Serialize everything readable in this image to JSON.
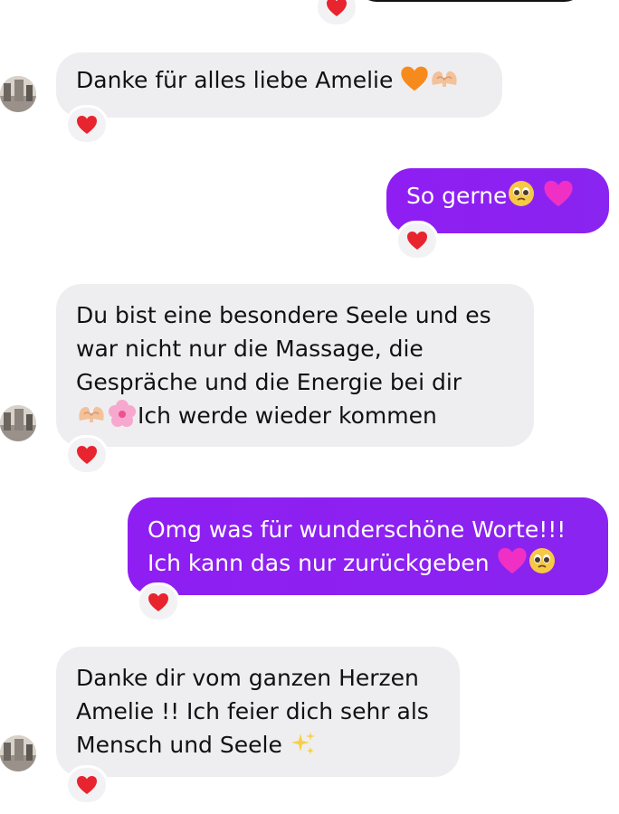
{
  "messages": [
    {
      "direction": "incoming",
      "lines": [
        "Danke für alles liebe Amelie"
      ],
      "trailing_emoji": [
        "orange-heart-icon",
        "heart-hands-icon"
      ],
      "reaction": "red-heart-icon"
    },
    {
      "direction": "outgoing",
      "lines": [
        "So gerne"
      ],
      "trailing_emoji": [
        "pleading-face-icon",
        "pink-heart-icon"
      ],
      "reaction": "red-heart-icon"
    },
    {
      "direction": "incoming",
      "lines": [
        "Du bist eine besondere Seele und es",
        "war nicht nur die Massage, die",
        "Gespräche und die Energie bei dir",
        "Ich werde wieder kommen"
      ],
      "leading_emoji_line4": [
        "heart-hands-icon",
        "cherry-blossom-icon"
      ],
      "reaction": "red-heart-icon"
    },
    {
      "direction": "outgoing",
      "lines": [
        "Omg was für wunderschöne Worte!!!",
        "Ich kann das nur zurückgeben"
      ],
      "trailing_emoji": [
        "pink-heart-icon",
        "pleading-face-icon"
      ],
      "reaction": "red-heart-icon"
    },
    {
      "direction": "incoming",
      "lines": [
        "Danke dir vom ganzen Herzen",
        "Amelie !! Ich feier dich sehr als",
        "Mensch und Seele"
      ],
      "trailing_emoji": [
        "sparkles-icon"
      ],
      "reaction": "red-heart-icon"
    }
  ],
  "colors": {
    "incoming_bubble": "#eeeef0",
    "outgoing_bubble": "#8a1ff0",
    "reaction_heart": "#e8242f"
  }
}
